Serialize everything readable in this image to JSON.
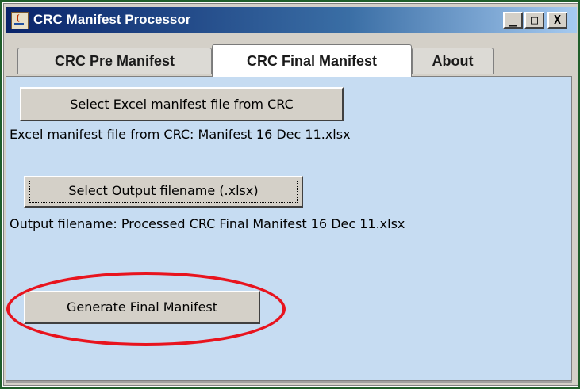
{
  "window": {
    "title": "CRC Manifest Processor",
    "controls": {
      "minimize": "_",
      "maximize": "□",
      "close": "X"
    }
  },
  "tabs": [
    {
      "label": "CRC Pre Manifest",
      "selected": false
    },
    {
      "label": "CRC Final Manifest",
      "selected": true
    },
    {
      "label": "About",
      "selected": false
    }
  ],
  "panel": {
    "select_excel_button": "Select Excel manifest file from CRC",
    "excel_label": "Excel manifest file from CRC:  Manifest 16 Dec 11.xlsx",
    "select_output_button": "Select Output filename (.xlsx)",
    "output_label": "Output filename:  Processed CRC Final Manifest 16 Dec 11.xlsx",
    "generate_button": "Generate Final Manifest"
  },
  "colors": {
    "panel_background": "#c6dcf2",
    "highlight_ring": "#e8141e",
    "frame": "#1f5e2a"
  },
  "icons": {
    "app": "java-cup-icon"
  }
}
